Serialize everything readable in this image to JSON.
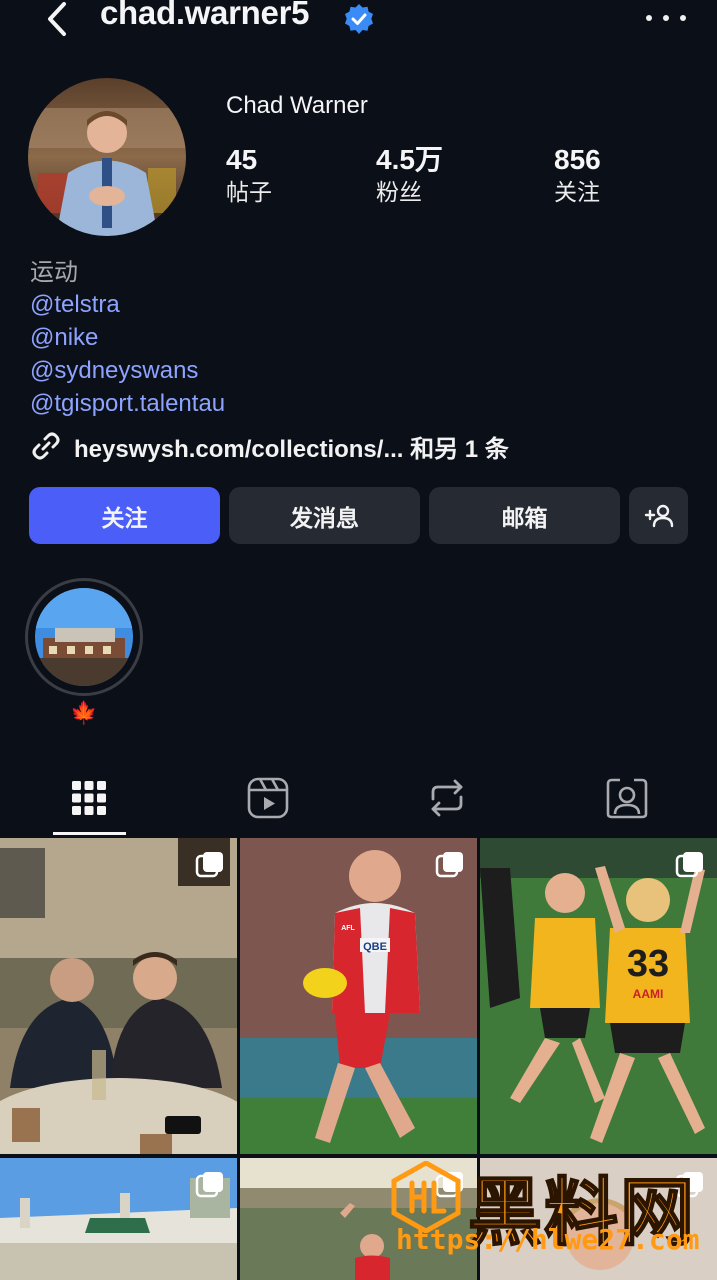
{
  "header": {
    "username": "chad.warner5",
    "back_icon": "chevron-left-icon",
    "verified_icon": "verified-badge-icon",
    "more_icon": "more-dots-icon"
  },
  "profile": {
    "display_name": "Chad Warner",
    "stats": [
      {
        "value": "45",
        "label": "帖子"
      },
      {
        "value": "4.5万",
        "label": "粉丝"
      },
      {
        "value": "856",
        "label": "关注"
      }
    ],
    "bio": {
      "category": "运动",
      "mentions": [
        "@telstra",
        "@nike",
        "@sydneyswans",
        "@tgisport.talentau"
      ],
      "link": "heyswysh.com/collections/... 和另 1 条"
    }
  },
  "actions": {
    "follow": "关注",
    "message": "发消息",
    "email": "邮箱",
    "add_user_icon": "add-person-icon"
  },
  "highlights": [
    {
      "label": "🍁"
    }
  ],
  "tabs": [
    {
      "name": "posts",
      "icon": "grid-icon",
      "active": true
    },
    {
      "name": "reels",
      "icon": "reels-icon",
      "active": false
    },
    {
      "name": "reposts",
      "icon": "repost-icon",
      "active": false
    },
    {
      "name": "tagged",
      "icon": "tagged-person-icon",
      "active": false
    }
  ],
  "posts": [
    {
      "caption": "",
      "multi": true
    },
    {
      "caption": "",
      "multi": true
    },
    {
      "caption": "",
      "multi": true
    },
    {
      "caption": "",
      "multi": true
    },
    {
      "caption": "",
      "multi": true
    },
    {
      "caption": "",
      "multi": true
    }
  ],
  "jersey_text": {
    "sponsor": "QBE",
    "league": "AFL",
    "number": "33",
    "sleeve": "AAMI"
  },
  "watermark": {
    "title": "黑料网",
    "url": "https://hlwe27.com"
  },
  "colors": {
    "background": "#0b0f17",
    "primary_button": "#4b5ef7",
    "secondary_button": "#262a33",
    "link": "#8da3ff",
    "verified": "#3a8bf5",
    "watermark": "#ff9a12"
  }
}
